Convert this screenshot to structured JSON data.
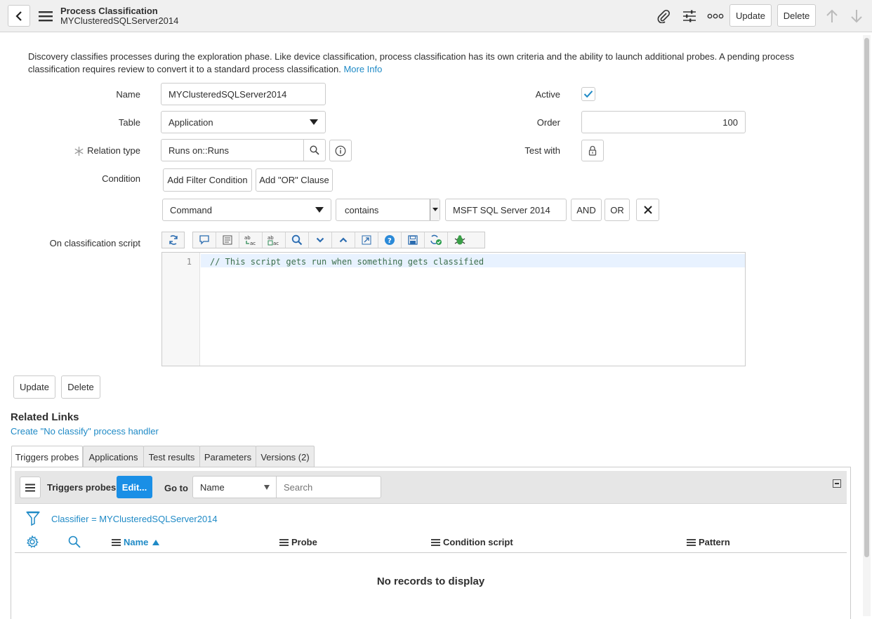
{
  "header": {
    "title": "Process Classification",
    "subtitle": "MYClusteredSQLServer2014",
    "update_label": "Update",
    "delete_label": "Delete"
  },
  "description": {
    "text": "Discovery classifies processes during the exploration phase. Like device classification, process classification has its own criteria and the ability to launch additional probes. A pending process classification requires review to convert it to a standard process classification.",
    "more_info": "More Info"
  },
  "form": {
    "name_label": "Name",
    "name_value": "MYClusteredSQLServer2014",
    "table_label": "Table",
    "table_value": "Application",
    "relation_label": "Relation type",
    "relation_value": "Runs on::Runs",
    "condition_label": "Condition",
    "add_filter_label": "Add Filter Condition",
    "add_or_label": "Add \"OR\" Clause",
    "cond_field": "Command",
    "cond_operator": "contains",
    "cond_value": "MSFT SQL Server 2014",
    "and_label": "AND",
    "or_label": "OR",
    "active_label": "Active",
    "active_checked": true,
    "order_label": "Order",
    "order_value": "100",
    "test_with_label": "Test with",
    "script_label": "On classification script",
    "script_line_number": "1",
    "script_code": "// This script gets run when something gets classified"
  },
  "bottom_buttons": {
    "update": "Update",
    "delete": "Delete"
  },
  "related_links": {
    "heading": "Related Links",
    "link": "Create \"No classify\" process handler"
  },
  "tabs": [
    {
      "label": "Triggers probes",
      "active": true
    },
    {
      "label": "Applications",
      "active": false
    },
    {
      "label": "Test results",
      "active": false
    },
    {
      "label": "Parameters",
      "active": false
    },
    {
      "label": "Versions (2)",
      "active": false
    }
  ],
  "list": {
    "title": "Triggers probes",
    "edit_label": "Edit...",
    "goto_label": "Go to",
    "goto_field": "Name",
    "search_placeholder": "Search",
    "breadcrumb": "Classifier = MYClusteredSQLServer2014",
    "columns": [
      "Name",
      "Probe",
      "Condition script",
      "Pattern"
    ],
    "sorted_column": "Name",
    "empty_message": "No records to display"
  },
  "colors": {
    "link": "#1f8ac6",
    "primary_button": "#1a8fe6",
    "header_bg": "#f0f0f0"
  }
}
